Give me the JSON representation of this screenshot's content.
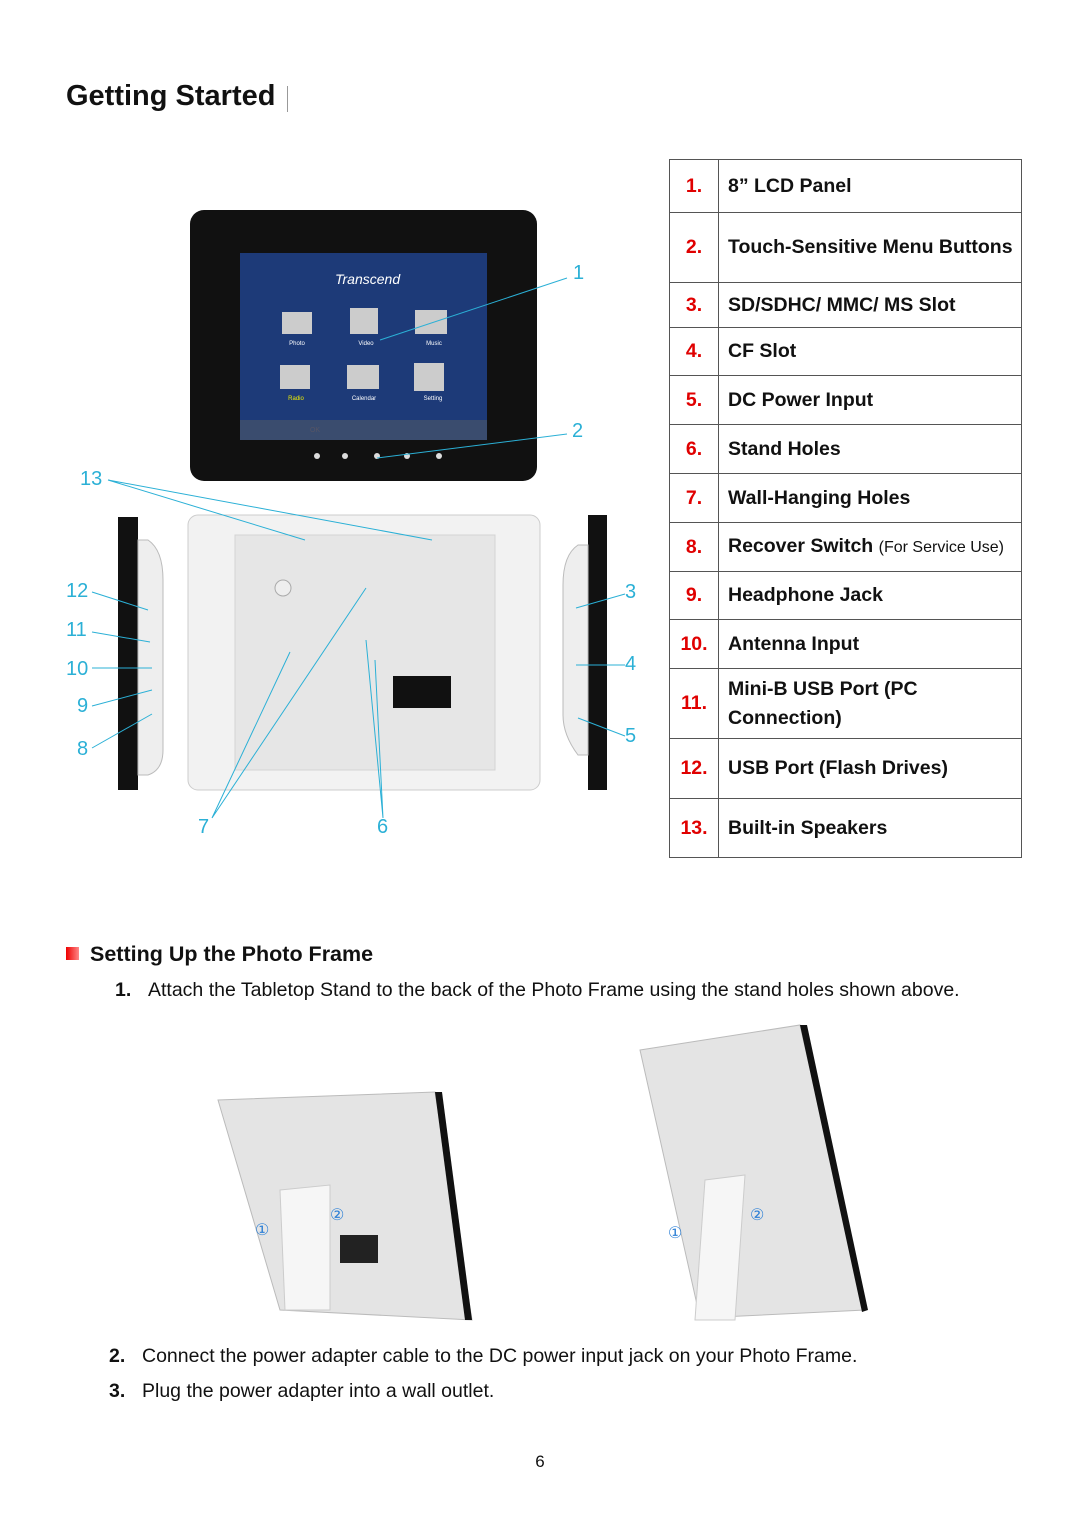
{
  "title": "Getting Started",
  "figure": {
    "brand": "Transcend",
    "screen_icons": [
      "Photo",
      "Video",
      "Music",
      "Radio",
      "Calendar",
      "Setting"
    ],
    "screen_bar": "OK",
    "callouts": {
      "c1": "1",
      "c2": "2",
      "c3": "3",
      "c4": "4",
      "c5": "5",
      "c6": "6",
      "c7": "7",
      "c8": "8",
      "c9": "9",
      "c10": "10",
      "c11": "11",
      "c12": "12",
      "c13": "13"
    },
    "callout_color": "#2bb0d6"
  },
  "parts": [
    {
      "num": "1.",
      "label": "8” LCD Panel"
    },
    {
      "num": "2.",
      "label": "Touch-Sensitive Menu Buttons"
    },
    {
      "num": "3.",
      "label": "SD/SDHC/ MMC/ MS Slot"
    },
    {
      "num": "4.",
      "label": "CF Slot"
    },
    {
      "num": "5.",
      "label": "DC Power Input"
    },
    {
      "num": "6.",
      "label": "Stand Holes"
    },
    {
      "num": "7.",
      "label": "Wall-Hanging Holes"
    },
    {
      "num": "8.",
      "label": "Recover Switch",
      "note": "(For Service Use)"
    },
    {
      "num": "9.",
      "label": "Headphone Jack"
    },
    {
      "num": "10.",
      "label": "Antenna Input"
    },
    {
      "num": "11.",
      "label": "Mini-B USB Port (PC Connection)"
    },
    {
      "num": "12.",
      "label": "USB Port (Flash Drives)"
    },
    {
      "num": "13.",
      "label": "Built-in Speakers"
    }
  ],
  "section": {
    "title": "Setting Up the Photo Frame",
    "accent": "#e00000",
    "steps": [
      {
        "num": "1.",
        "text": "Attach the Tabletop Stand to the back of the Photo Frame using the stand holes shown above."
      },
      {
        "num": "2.",
        "text": "Connect the power adapter cable to the DC power input jack on your Photo Frame."
      },
      {
        "num": "3.",
        "text": "Plug the power adapter into a wall outlet."
      }
    ],
    "stand_marks": [
      "①",
      "②"
    ]
  },
  "page_number": "6"
}
